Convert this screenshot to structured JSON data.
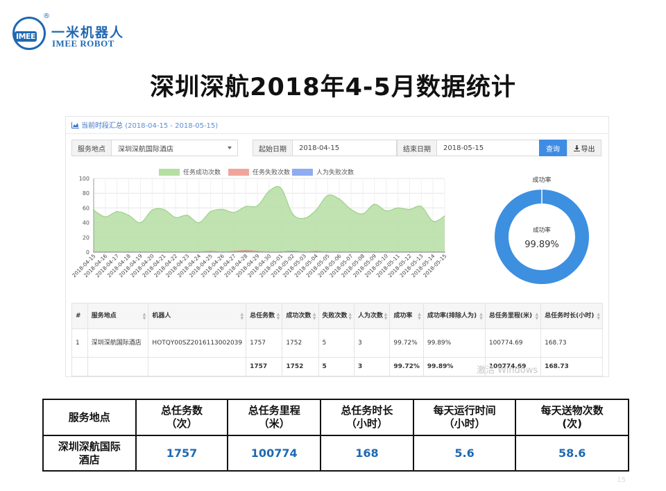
{
  "logo": {
    "mark": "IMEE",
    "reg": "®",
    "cn": "一米机器人",
    "en": "IMEE ROBOT"
  },
  "slide_title": "深圳深航2018年4-5月数据统计",
  "panel": {
    "heading": "当前时段汇总",
    "heading_range": "(2018-04-15 - 2018-05-15)",
    "filters": {
      "site_label": "服务地点",
      "site_value": "深圳深航国际酒店",
      "start_label": "起始日期",
      "start_value": "2018-04-15",
      "end_label": "结束日期",
      "end_value": "2018-05-15",
      "query_button": "查询",
      "export_button": "导出"
    }
  },
  "chart_data": [
    {
      "type": "area",
      "x": [
        "2018-04-15",
        "2018-04-16",
        "2018-04-17",
        "2018-04-18",
        "2018-04-19",
        "2018-04-20",
        "2018-04-21",
        "2018-04-22",
        "2018-04-23",
        "2018-04-24",
        "2018-04-25",
        "2018-04-26",
        "2018-04-27",
        "2018-04-28",
        "2018-04-29",
        "2018-04-30",
        "2018-05-01",
        "2018-05-02",
        "2018-05-03",
        "2018-05-04",
        "2018-05-05",
        "2018-05-06",
        "2018-05-07",
        "2018-05-08",
        "2018-05-09",
        "2018-05-10",
        "2018-05-11",
        "2018-05-12",
        "2018-05-13",
        "2018-05-14",
        "2018-05-15"
      ],
      "series": [
        {
          "name": "任务成功次数",
          "color": "#b5dea3",
          "line": "#9fd18b",
          "values": [
            57,
            48,
            55,
            50,
            40,
            57,
            58,
            47,
            50,
            40,
            55,
            58,
            54,
            62,
            63,
            83,
            87,
            52,
            46,
            57,
            77,
            72,
            58,
            52,
            65,
            56,
            60,
            58,
            62,
            42,
            49
          ]
        },
        {
          "name": "任务失败次数",
          "color": "#f0a59c",
          "line": "#ee8f84",
          "values": [
            0,
            0,
            0,
            0,
            0,
            0,
            0,
            0,
            0,
            0,
            1,
            0,
            1,
            2,
            1,
            0,
            0,
            1,
            0,
            1,
            0,
            0,
            0,
            0,
            0,
            0,
            0,
            0,
            0,
            0,
            0
          ]
        },
        {
          "name": "人为失败次数",
          "color": "#8fabf2",
          "line": "#7f9ee8",
          "values": [
            0,
            0,
            0,
            0,
            0,
            0,
            0,
            0,
            0,
            0,
            0,
            0,
            0,
            1,
            0,
            0,
            0,
            1,
            0,
            0,
            0,
            0,
            0,
            0,
            0,
            0,
            0,
            0,
            0,
            0,
            0
          ]
        }
      ],
      "yticks": [
        0,
        20,
        40,
        60,
        80,
        100
      ],
      "ylim": [
        0,
        100
      ],
      "grid": true,
      "legend_position": "top"
    },
    {
      "type": "pie",
      "title": "成功率",
      "center_label": "成功率",
      "center_value": "99.89%",
      "slices": [
        {
          "value": 99.89,
          "color": "#3d8fe0"
        },
        {
          "value": 0.11,
          "color": "#dfe9f6"
        }
      ]
    }
  ],
  "grid_table": {
    "headers": [
      "#",
      "服务地点",
      "机器人",
      "总任务数",
      "成功次数",
      "失败次数",
      "人为次数",
      "成功率",
      "成功率(排除人为)",
      "总任务里程(米)",
      "总任务时长(小时)"
    ],
    "rows": [
      [
        "1",
        "深圳深航国际酒店",
        "HOTQY00SZ2016113002039",
        "1757",
        "1752",
        "5",
        "3",
        "99.72%",
        "99.89%",
        "100774.69",
        "168.73"
      ]
    ],
    "total": [
      "",
      "",
      "",
      "1757",
      "1752",
      "5",
      "3",
      "99.72%",
      "99.89%",
      "100774.69",
      "168.73"
    ]
  },
  "watermark": "激活 Windows",
  "summary": {
    "headers": [
      "服务地点",
      "总任务数\n（次）",
      "总任务里程\n（米）",
      "总任务时长\n（小时）",
      "每天运行时间\n（小时）",
      "每天送物次数\n(次)"
    ],
    "row": [
      "深圳深航国际\n酒店",
      "1757",
      "100774",
      "168",
      "5.6",
      "58.6"
    ]
  },
  "page_number": "15"
}
